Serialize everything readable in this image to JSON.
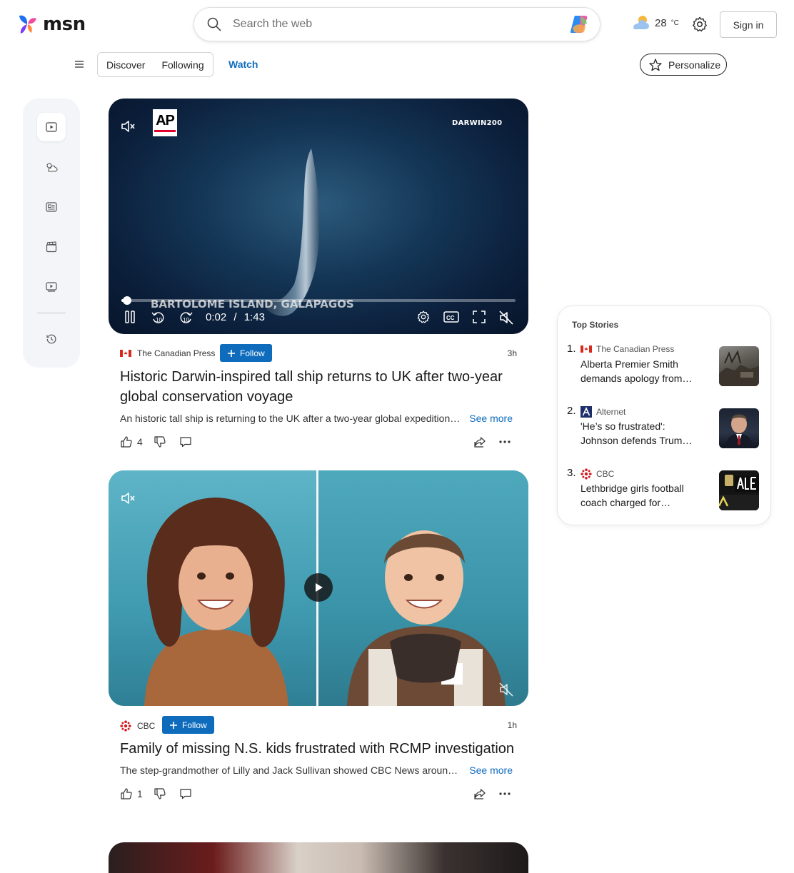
{
  "header": {
    "logo_text": "msn",
    "search_placeholder": "Search the web",
    "temperature": "28",
    "temp_unit": "°C",
    "signin_label": "Sign in"
  },
  "nav": {
    "tabs": [
      {
        "label": "Discover"
      },
      {
        "label": "Following"
      },
      {
        "label": "Watch"
      }
    ],
    "personalize_label": "Personalize"
  },
  "rail": {
    "items": [
      {
        "icon": "video-feed-icon"
      },
      {
        "icon": "weather-icon"
      },
      {
        "icon": "news-icon"
      },
      {
        "icon": "clapperboard-icon"
      },
      {
        "icon": "video-library-icon"
      },
      {
        "icon": "history-icon"
      }
    ]
  },
  "cards": [
    {
      "source": "The Canadian Press",
      "follow_label": "Follow",
      "age": "3h",
      "headline": "Historic Darwin-inspired tall ship returns to UK after two-year global conservation voyage",
      "summary": "An historic tall ship is returning to the UK after a two-year global expedition…",
      "see_more": "See more",
      "likes": "4",
      "video": {
        "watermark": "DARWIN200",
        "caption": "BARTOLOME ISLAND, GALAPAGOS",
        "current_time": "0:02",
        "separator": "/",
        "duration": "1:43",
        "progress": 0.015,
        "skip_back": "10",
        "skip_forward": "10",
        "cc": "CC"
      }
    },
    {
      "source": "CBC",
      "follow_label": "Follow",
      "age": "1h",
      "headline": "Family of missing N.S. kids frustrated with RCMP investigation",
      "summary": "The step-grandmother of Lilly and Jack Sullivan showed CBC News around th…",
      "see_more": "See more",
      "likes": "1"
    }
  ],
  "top_stories": {
    "title": "Top Stories",
    "items": [
      {
        "num": "1.",
        "source": "The Canadian Press",
        "title": "Alberta Premier Smith demands apology from…"
      },
      {
        "num": "2.",
        "source": "Alternet",
        "title": "'He’s so frustrated': Johnson defends Trum…"
      },
      {
        "num": "3.",
        "source": "CBC",
        "title": "Lethbridge girls football coach charged for…"
      }
    ]
  },
  "colors": {
    "accent": "#0f6cbd",
    "rail_bg": "#f3f5f9"
  }
}
